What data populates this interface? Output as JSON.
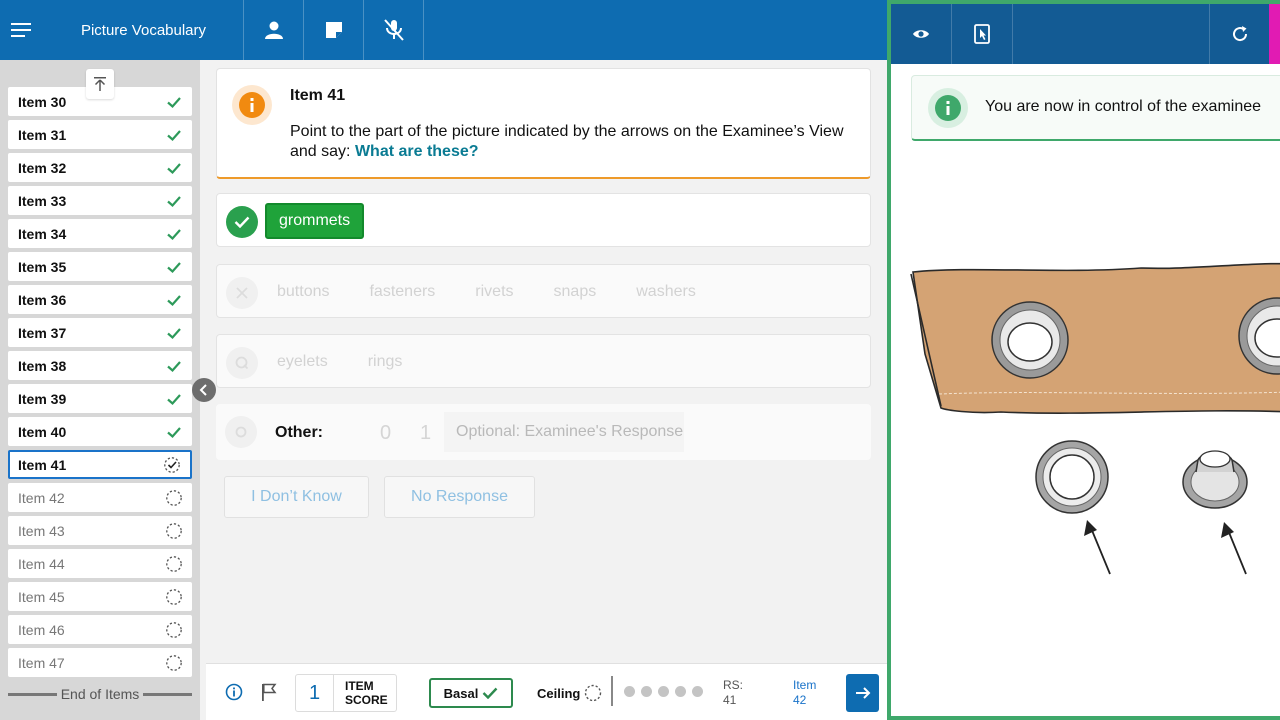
{
  "topbar": {
    "title": "Picture Vocabulary",
    "icons": [
      "menu-icon",
      "person-icon",
      "note-icon",
      "mic-off-icon"
    ]
  },
  "sidebar": {
    "items": [
      {
        "label": "Item 30",
        "status": "done"
      },
      {
        "label": "Item 31",
        "status": "done"
      },
      {
        "label": "Item 32",
        "status": "done"
      },
      {
        "label": "Item 33",
        "status": "done"
      },
      {
        "label": "Item 34",
        "status": "done"
      },
      {
        "label": "Item 35",
        "status": "done"
      },
      {
        "label": "Item 36",
        "status": "done"
      },
      {
        "label": "Item 37",
        "status": "done"
      },
      {
        "label": "Item 38",
        "status": "done"
      },
      {
        "label": "Item 39",
        "status": "done"
      },
      {
        "label": "Item 40",
        "status": "done"
      },
      {
        "label": "Item 41",
        "status": "current"
      },
      {
        "label": "Item 42",
        "status": "pending"
      },
      {
        "label": "Item 43",
        "status": "pending"
      },
      {
        "label": "Item 44",
        "status": "pending"
      },
      {
        "label": "Item 45",
        "status": "pending"
      },
      {
        "label": "Item 46",
        "status": "pending"
      },
      {
        "label": "Item 47",
        "status": "pending"
      }
    ],
    "end_label": "End of Items"
  },
  "question": {
    "title": "Item 41",
    "instruction": "Point to the part of the picture indicated by the arrows on the Examinee’s View and say: ",
    "prompt": "What are these?"
  },
  "responses": {
    "correct": "grommets",
    "incorrect": [
      "buttons",
      "fasteners",
      "rivets",
      "snaps",
      "washers"
    ],
    "query": [
      "eyelets",
      "rings"
    ],
    "other_label": "Other:",
    "score_options": [
      "0",
      "1"
    ],
    "other_placeholder": "Optional: Examinee's Response"
  },
  "actions": {
    "dont_know": "I Don’t Know",
    "no_response": "No Response"
  },
  "footer": {
    "item_score_value": "1",
    "item_score_label_1": "ITEM",
    "item_score_label_2": "SCORE",
    "basal_label": "Basal",
    "ceiling_label": "Ceiling",
    "rs_label": "RS:",
    "rs_value": "41",
    "next_label": "Item",
    "next_value": "42"
  },
  "examinee_view": {
    "notice": "You are now in control of the examinee"
  },
  "colors": {
    "brand_blue": "#0e6cb1",
    "correct_green": "#1fa33a",
    "warning_orange": "#f18a10",
    "examinee_border": "#3fa86b",
    "accent_pink": "#e11bb3"
  }
}
